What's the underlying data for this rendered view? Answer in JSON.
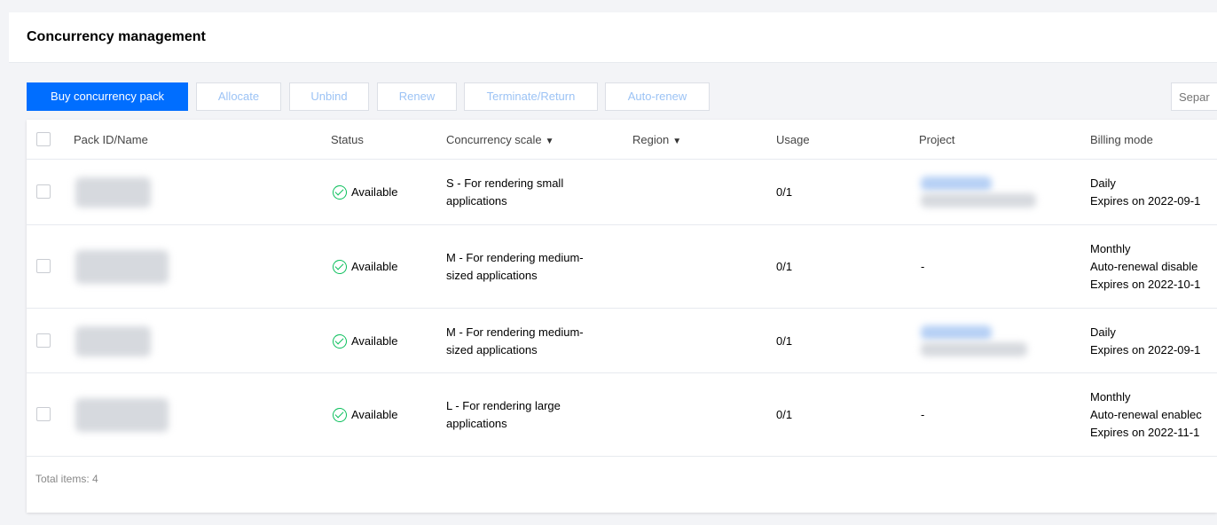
{
  "page": {
    "title": "Concurrency management"
  },
  "toolbar": {
    "buy": "Buy concurrency pack",
    "allocate": "Allocate",
    "unbind": "Unbind",
    "renew": "Renew",
    "terminate": "Terminate/Return",
    "auto_renew": "Auto-renew",
    "search_placeholder": "Separ"
  },
  "columns": {
    "pack": "Pack ID/Name",
    "status": "Status",
    "scale": "Concurrency scale",
    "region": "Region",
    "usage": "Usage",
    "project": "Project",
    "billing": "Billing mode"
  },
  "rows": [
    {
      "status": "Available",
      "scale1": "S - For rendering small",
      "scale2": "applications",
      "usage": "0/1",
      "project": "",
      "billing1": "Daily",
      "billing2": "Expires on 2022-09-1",
      "billing3": ""
    },
    {
      "status": "Available",
      "scale1": "M - For rendering medium-",
      "scale2": "sized applications",
      "usage": "0/1",
      "project": "-",
      "billing1": "Monthly",
      "billing2": "Auto-renewal disable",
      "billing3": "Expires on 2022-10-1"
    },
    {
      "status": "Available",
      "scale1": "M - For rendering medium-",
      "scale2": "sized applications",
      "usage": "0/1",
      "project": "",
      "billing1": "Daily",
      "billing2": "Expires on 2022-09-1",
      "billing3": ""
    },
    {
      "status": "Available",
      "scale1": "L - For rendering large",
      "scale2": "applications",
      "usage": "0/1",
      "project": "-",
      "billing1": "Monthly",
      "billing2": "Auto-renewal enablec",
      "billing3": "Expires on 2022-11-1"
    }
  ],
  "footer": {
    "total": "Total items:  4"
  }
}
